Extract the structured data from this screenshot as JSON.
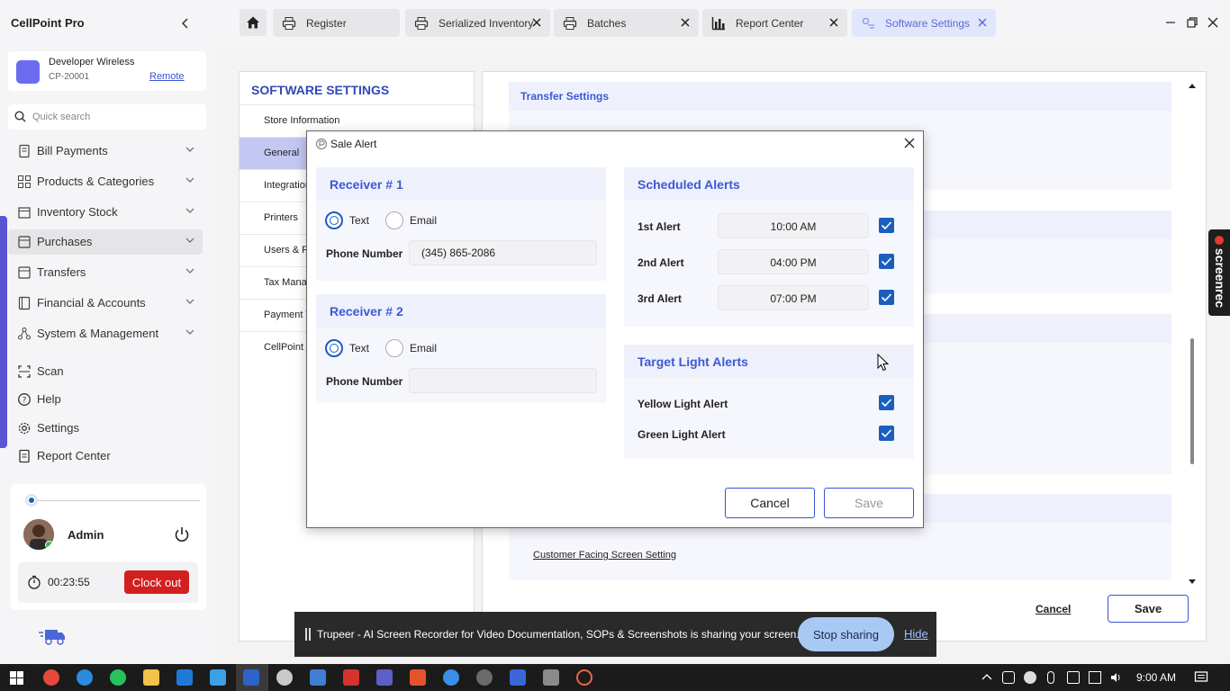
{
  "app": {
    "title": "CellPoint Pro",
    "store_name": "Developer Wireless",
    "store_id": "CP-20001",
    "store_link": "Remote",
    "search_placeholder": "Quick search"
  },
  "nav": {
    "items": [
      {
        "label": "Bill Payments",
        "icon": "receipt-icon",
        "has_chevron": true
      },
      {
        "label": "Products & Categories",
        "icon": "grid-icon",
        "has_chevron": true
      },
      {
        "label": "Inventory Stock",
        "icon": "box-icon",
        "has_chevron": true
      },
      {
        "label": "Purchases",
        "icon": "cart-icon",
        "has_chevron": true,
        "active": true
      },
      {
        "label": "Transfers",
        "icon": "transfer-icon",
        "has_chevron": true
      },
      {
        "label": "Financial & Accounts",
        "icon": "ledger-icon",
        "has_chevron": true
      },
      {
        "label": "System & Management",
        "icon": "nodes-icon",
        "has_chevron": true
      },
      {
        "label": "Scan",
        "icon": "scan-icon"
      },
      {
        "label": "Help",
        "icon": "help-icon"
      },
      {
        "label": "Settings",
        "icon": "gear-icon"
      },
      {
        "label": "Report Center",
        "icon": "report-icon"
      }
    ]
  },
  "user": {
    "name": "Admin",
    "timer": "00:23:55",
    "clock_out_label": "Clock out"
  },
  "tabs": [
    {
      "label": "Register",
      "icon": "printer-icon",
      "closable": false
    },
    {
      "label": "Serialized Inventory",
      "icon": "printer-icon",
      "closable": true
    },
    {
      "label": "Batches",
      "icon": "printer-icon",
      "closable": true
    },
    {
      "label": "Report Center",
      "icon": "bar-chart-icon",
      "closable": true
    },
    {
      "label": "Software Settings",
      "icon": "settings-icon",
      "closable": true,
      "active": true
    }
  ],
  "settings": {
    "title": "SOFTWARE SETTINGS",
    "menu": [
      "Store Information",
      "General",
      "Integration",
      "Printers",
      "Users & R",
      "Tax Manag",
      "Payment T",
      "CellPoint A"
    ],
    "active_index": 1,
    "transfer_heading": "Transfer Settings",
    "customer_link": "Customer Facing Screen Setting",
    "cancel_label": "Cancel",
    "save_label": "Save"
  },
  "modal": {
    "title": "Sale Alert",
    "receiver1": {
      "heading": "Receiver # 1",
      "option_text": "Text",
      "option_email": "Email",
      "selected": "Text",
      "phone_label": "Phone Number",
      "phone_value": "(345) 865-2086"
    },
    "receiver2": {
      "heading": "Receiver # 2",
      "option_text": "Text",
      "option_email": "Email",
      "selected": "Text",
      "phone_label": "Phone Number",
      "phone_value": ""
    },
    "scheduled": {
      "heading": "Scheduled Alerts",
      "alerts": [
        {
          "label": "1st Alert",
          "time": "10:00 AM",
          "checked": true
        },
        {
          "label": "2nd Alert",
          "time": "04:00 PM",
          "checked": true
        },
        {
          "label": "3rd Alert",
          "time": "07:00 PM",
          "checked": true
        }
      ]
    },
    "target": {
      "heading": "Target Light Alerts",
      "alerts": [
        {
          "label": "Yellow Light Alert",
          "checked": true
        },
        {
          "label": "Green Light Alert",
          "checked": true
        }
      ]
    },
    "cancel_label": "Cancel",
    "save_label": "Save"
  },
  "screenrec": {
    "label": "screenrec"
  },
  "sharebar": {
    "message": "Trupeer - AI Screen Recorder for Video Documentation, SOPs & Screenshots is sharing your screen.",
    "stop_label": "Stop sharing",
    "hide_label": "Hide"
  },
  "taskbar": {
    "time": "9:00 AM"
  },
  "colors": {
    "accent": "#3e58d6",
    "checkbox": "#1a5fc0",
    "clock_out": "#d41f1f",
    "section_band": "#eef1fc"
  }
}
